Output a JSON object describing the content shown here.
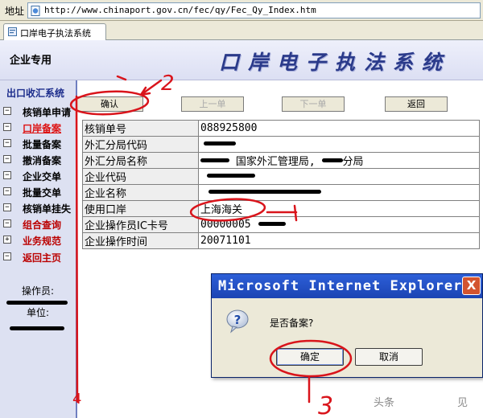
{
  "address_bar": {
    "label": "地址",
    "url": "http://www.chinaport.gov.cn/fec/qy/Fec_Qy_Index.htm"
  },
  "tab": {
    "title": "口岸电子执法系统"
  },
  "header": {
    "left_label": "企业专用",
    "title": "口岸电子执法系统"
  },
  "sidebar": {
    "section_title": "出口收汇系统",
    "items": [
      {
        "box": "−",
        "label": "核销单申请"
      },
      {
        "box": "−",
        "label": "口岸备案"
      },
      {
        "box": "−",
        "label": "批量备案"
      },
      {
        "box": "−",
        "label": "撤消备案"
      },
      {
        "box": "−",
        "label": "企业交单"
      },
      {
        "box": "−",
        "label": "批量交单"
      },
      {
        "box": "−",
        "label": "核销单挂失"
      },
      {
        "box": "−",
        "label": "组合查询"
      },
      {
        "box": "+",
        "label": "业务规范"
      },
      {
        "box": "−",
        "label": "返回主页"
      }
    ],
    "operator_label": "操作员:",
    "unit_label": "单位:"
  },
  "toolbar": {
    "confirm": "确认",
    "prev": "上一单",
    "next": "下一单",
    "back": "返回"
  },
  "form": {
    "rows": [
      {
        "label": "核销单号",
        "value": "088925800"
      },
      {
        "label": "外汇分局代码",
        "value": ""
      },
      {
        "label": "外汇分局名称",
        "value": "国家外汇管理局",
        "suffix": "分局"
      },
      {
        "label": "企业代码",
        "value": ""
      },
      {
        "label": "企业名称",
        "value": ""
      },
      {
        "label": "使用口岸",
        "value": "上海海关"
      },
      {
        "label": "企业操作员IC卡号",
        "value": "00000005"
      },
      {
        "label": "企业操作时间",
        "value": "20071101"
      }
    ]
  },
  "dialog": {
    "title": "Microsoft Internet Explorer",
    "close": "X",
    "message": "是否备案?",
    "ok": "确定",
    "cancel": "取消"
  },
  "annotations": {
    "step2": "2",
    "step3": "3",
    "step4": "4"
  },
  "watermark": {
    "text": "头条",
    "logo": "",
    "trail": "见"
  },
  "colors": {
    "title_blue": "#2a3a8a",
    "annotation_red": "#d9141b",
    "dialog_titlebar": "#2d5fd8"
  }
}
